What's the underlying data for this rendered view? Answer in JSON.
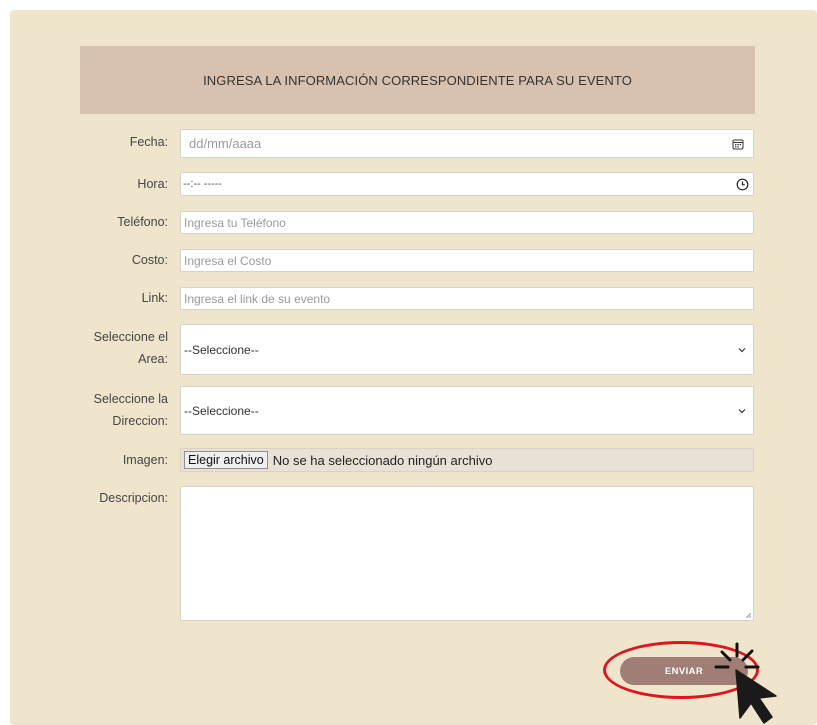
{
  "header": {
    "title": "INGRESA LA INFORMACIÓN CORRESPONDIENTE PARA SU EVENTO"
  },
  "form": {
    "fecha": {
      "label": "Fecha:",
      "placeholder": "dd/mm/aaaa",
      "icon": "calendar-icon"
    },
    "hora": {
      "label": "Hora:",
      "placeholder": "--:-- -----",
      "icon": "clock-icon"
    },
    "telefono": {
      "label": "Teléfono:",
      "placeholder": "Ingresa tu Teléfono"
    },
    "costo": {
      "label": "Costo:",
      "placeholder": "Ingresa el Costo"
    },
    "link": {
      "label": "Link:",
      "placeholder": "Ingresa el link de su evento"
    },
    "area": {
      "label_line1": "Seleccione el",
      "label_line2": "Area:",
      "selected": "--Seleccione--",
      "icon": "chevron-down-icon"
    },
    "direccion": {
      "label_line1": "Seleccione la",
      "label_line2": "Direccion:",
      "selected": "--Seleccione--",
      "icon": "chevron-down-icon"
    },
    "imagen": {
      "label": "Imagen:",
      "button": "Elegir archivo",
      "status": "No se ha seleccionado ningún archivo"
    },
    "descripcion": {
      "label": "Descripcion:",
      "value": ""
    }
  },
  "submit": {
    "label": "ENVIAR"
  },
  "colors": {
    "panel": "#efe5cd",
    "header": "#d9c1af",
    "button": "#a07d75",
    "highlight": "#e0141c"
  }
}
